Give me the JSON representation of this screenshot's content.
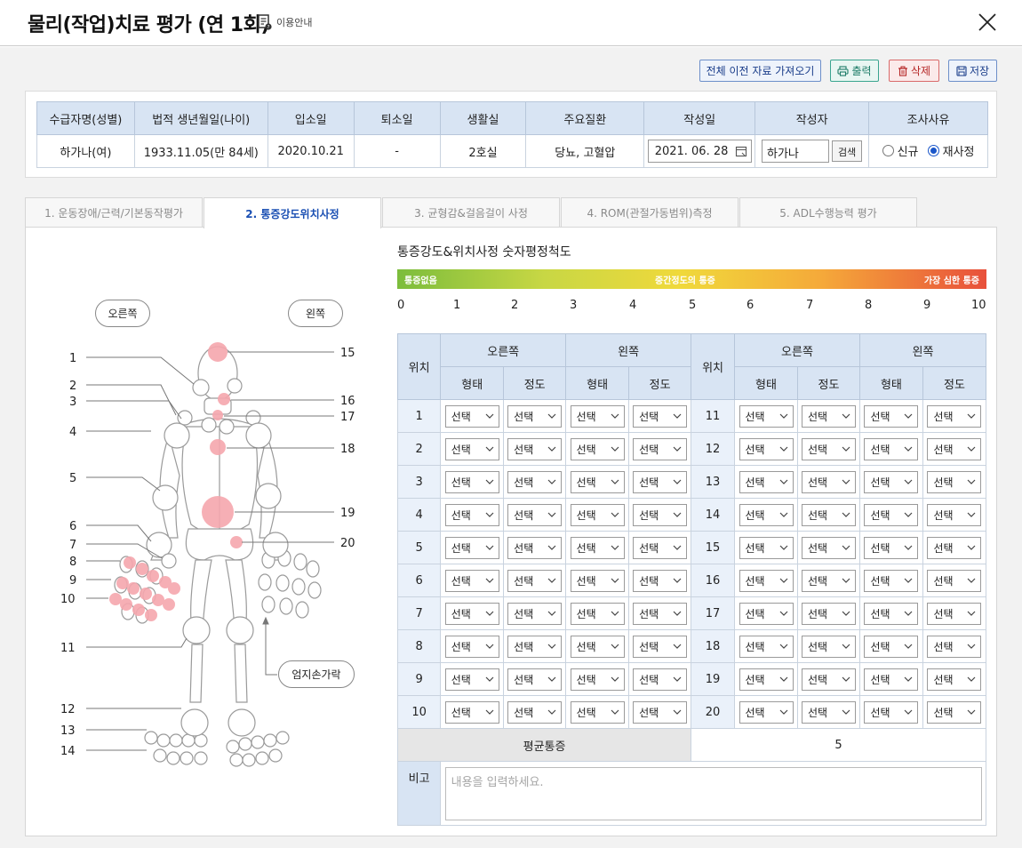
{
  "header": {
    "title": "물리(작업)치료 평가 (연 1회)",
    "guide_label": "이용안내"
  },
  "toolbar": {
    "import_label": "전체 이전 자료 가져오기",
    "print_label": "출력",
    "delete_label": "삭제",
    "save_label": "저장",
    "colors": {
      "print": "#3aa58f",
      "delete": "#d96a6a",
      "save": "#6d8fc9"
    }
  },
  "info": {
    "headers": [
      "수급자명(성별)",
      "법적 생년월일(나이)",
      "입소일",
      "퇴소일",
      "생활실",
      "주요질환",
      "작성일",
      "작성자",
      "조사사유"
    ],
    "name": "하가나(여)",
    "birth": "1933.11.05(만 84세)",
    "admit": "2020.10.21",
    "discharge": "-",
    "room": "2호실",
    "disease": "당뇨, 고혈압",
    "write_date": "2021. 06. 28",
    "writer": "하가나",
    "search_label": "검색",
    "reason_options": [
      "신규",
      "재사정"
    ],
    "reason_selected": "재사정"
  },
  "tabs": [
    {
      "label": "1. 운동장애/근력/기본동작평가",
      "active": false
    },
    {
      "label": "2. 통증강도위치사정",
      "active": true
    },
    {
      "label": "3. 균형감&걸음걸이 사정",
      "active": false
    },
    {
      "label": "4. ROM(관절가동범위)측정",
      "active": false
    },
    {
      "label": "5. ADL수행능력 평가",
      "active": false
    }
  ],
  "scale": {
    "title": "통증강도&위치사정 숫자평정척도",
    "left_label": "통증없음",
    "mid_label": "중간정도의 통증",
    "right_label": "가장 심한 통증",
    "numbers": [
      "0",
      "1",
      "2",
      "3",
      "4",
      "5",
      "6",
      "7",
      "8",
      "9",
      "10"
    ]
  },
  "table": {
    "position_header": "위치",
    "right_header": "오른쪽",
    "left_header": "왼쪽",
    "type_header": "형태",
    "degree_header": "정도",
    "select_placeholder": "선택",
    "rows_left": [
      "1",
      "2",
      "3",
      "4",
      "5",
      "6",
      "7",
      "8",
      "9",
      "10"
    ],
    "rows_right": [
      "11",
      "12",
      "13",
      "14",
      "15",
      "16",
      "17",
      "18",
      "19",
      "20"
    ],
    "avg_label": "평균통증",
    "avg_value": "5",
    "note_label": "비고",
    "note_placeholder": "내용을 입력하세요."
  },
  "diagram": {
    "right_label": "오른쪽",
    "left_label": "왼쪽",
    "thumb_label": "엄지손가락",
    "left_numbers": [
      "1",
      "2",
      "3",
      "4",
      "5",
      "6",
      "7",
      "8",
      "9",
      "10",
      "11",
      "12",
      "13",
      "14"
    ],
    "right_numbers": [
      "15",
      "16",
      "17",
      "18",
      "19",
      "20"
    ],
    "pain_color": "#f6a7ae"
  }
}
